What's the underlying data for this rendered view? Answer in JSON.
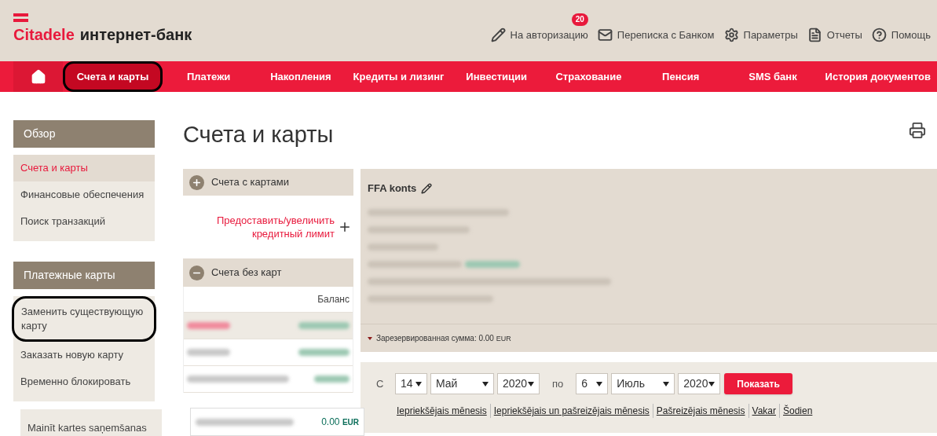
{
  "header": {
    "brand": "Citadele",
    "product": "интернет-банк",
    "actions": [
      {
        "kind": "pencil",
        "label": "На авторизацию",
        "badge": "20"
      },
      {
        "kind": "mail",
        "label": "Переписка с Банком"
      },
      {
        "kind": "gear",
        "label": "Параметры"
      },
      {
        "kind": "document",
        "label": "Отчеты"
      },
      {
        "kind": "help",
        "label": "Помощь"
      }
    ]
  },
  "nav": [
    {
      "label": "Счета и карты",
      "selected": true,
      "circled": true
    },
    {
      "label": "Платежи",
      "selected": false,
      "circled": false
    },
    {
      "label": "Накопления",
      "selected": false,
      "circled": false
    },
    {
      "label": "Кредиты и лизинг",
      "selected": false,
      "circled": false
    },
    {
      "label": "Инвестиции",
      "selected": false,
      "circled": false
    },
    {
      "label": "Страхование",
      "selected": false,
      "circled": false
    },
    {
      "label": "Пенсия",
      "selected": false,
      "circled": false
    },
    {
      "label": "SMS банк",
      "selected": false,
      "circled": false
    },
    {
      "label": "История документов",
      "selected": false,
      "circled": false
    }
  ],
  "sidebar": [
    {
      "title": "Обзор",
      "items": [
        {
          "label": "Счета и карты",
          "selected": true,
          "circled": false
        },
        {
          "label": "Финансовые обеспечения",
          "selected": false,
          "circled": false
        },
        {
          "label": "Поиск транзакций",
          "selected": false,
          "circled": false
        }
      ]
    },
    {
      "title": "Платежные карты",
      "items": [
        {
          "label": "Заменить существующую карту",
          "selected": false,
          "circled": true
        },
        {
          "label": "Заказать новую карту",
          "selected": false,
          "circled": false
        },
        {
          "label": "Временно блокировать",
          "selected": false,
          "circled": false
        }
      ]
    }
  ],
  "page_title": "Счета и карты",
  "accounts": {
    "group_with_cards": {
      "label": "Счета с картами",
      "expanded": false
    },
    "credit_link": "Предоставить/увеличить кредитный лимит",
    "group_without_cards": {
      "label": "Счета без карт",
      "expanded": true
    },
    "balance_header": "Баланс",
    "rows": [
      {
        "selected": true
      },
      {
        "selected": false
      },
      {
        "selected": false
      }
    ]
  },
  "details": {
    "title": "FFA konts",
    "reserved_label": "Зарезервированная сумма: 0.00",
    "reserved_currency": "EUR",
    "expanded": false
  },
  "filter": {
    "from_label": "С",
    "from": {
      "day": "14",
      "month": "Май",
      "year": "2020"
    },
    "to_label": "по",
    "to": {
      "day": "6",
      "month": "Июль",
      "year": "2020"
    },
    "button": "Показать",
    "links": [
      "Iepriekšējais mēnesis",
      "Iepriekšējais un pašreizējais mēnesis",
      "Pašreizējais mēnesis",
      "Vakar",
      "Šodien"
    ]
  },
  "overlay_menu_item": "Mainīt kartes saņemšanas",
  "overlay_balance": {
    "amount": "0.00",
    "currency": "EUR"
  }
}
